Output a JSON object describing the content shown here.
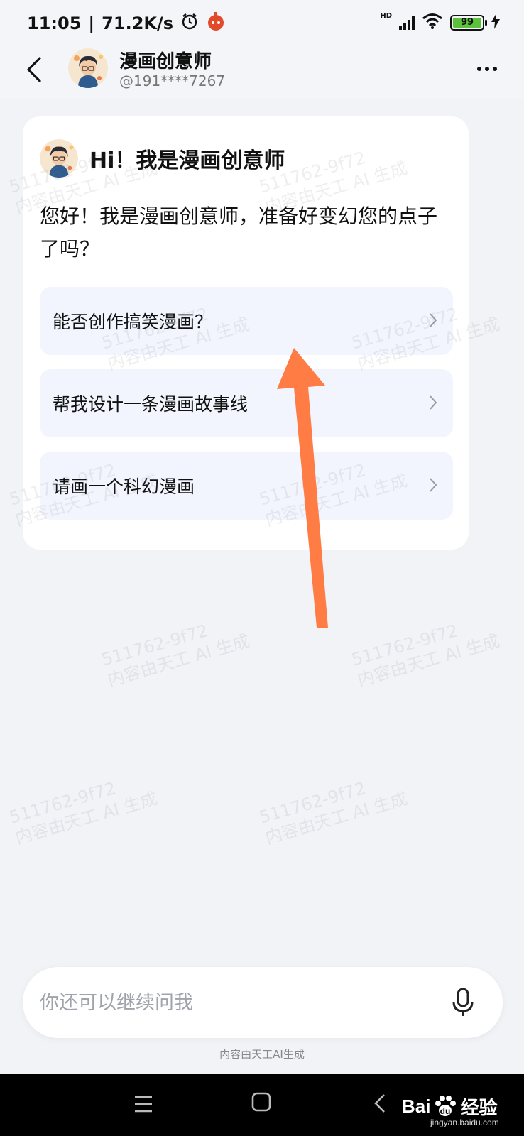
{
  "status_bar": {
    "time": "11:05",
    "net_speed": "71.2K/s",
    "signal_label": "HD",
    "battery": "99"
  },
  "header": {
    "title": "漫画创意师",
    "subtitle": "@191****7267"
  },
  "card": {
    "title": "Hi！我是漫画创意师",
    "greeting": "您好！我是漫画创意师，准备好变幻您的点子了吗？",
    "suggestions": [
      {
        "label": "能否创作搞笑漫画？"
      },
      {
        "label": "帮我设计一条漫画故事线"
      },
      {
        "label": "请画一个科幻漫画"
      }
    ]
  },
  "watermark": {
    "line1": "511762-9f72",
    "line2": "内容由天工 AI 生成"
  },
  "input": {
    "placeholder": "你还可以继续问我"
  },
  "footer_note": "内容由天工AI生成",
  "brand": {
    "logo_text": "Bai",
    "logo_text2": "经验",
    "logo_sub": "jingyan.baidu.com"
  },
  "colors": {
    "arrow": "#ff7d45",
    "battery": "#5cc23a",
    "suggestion_bg": "#f2f5fd",
    "page_bg": "#f2f3f7"
  }
}
